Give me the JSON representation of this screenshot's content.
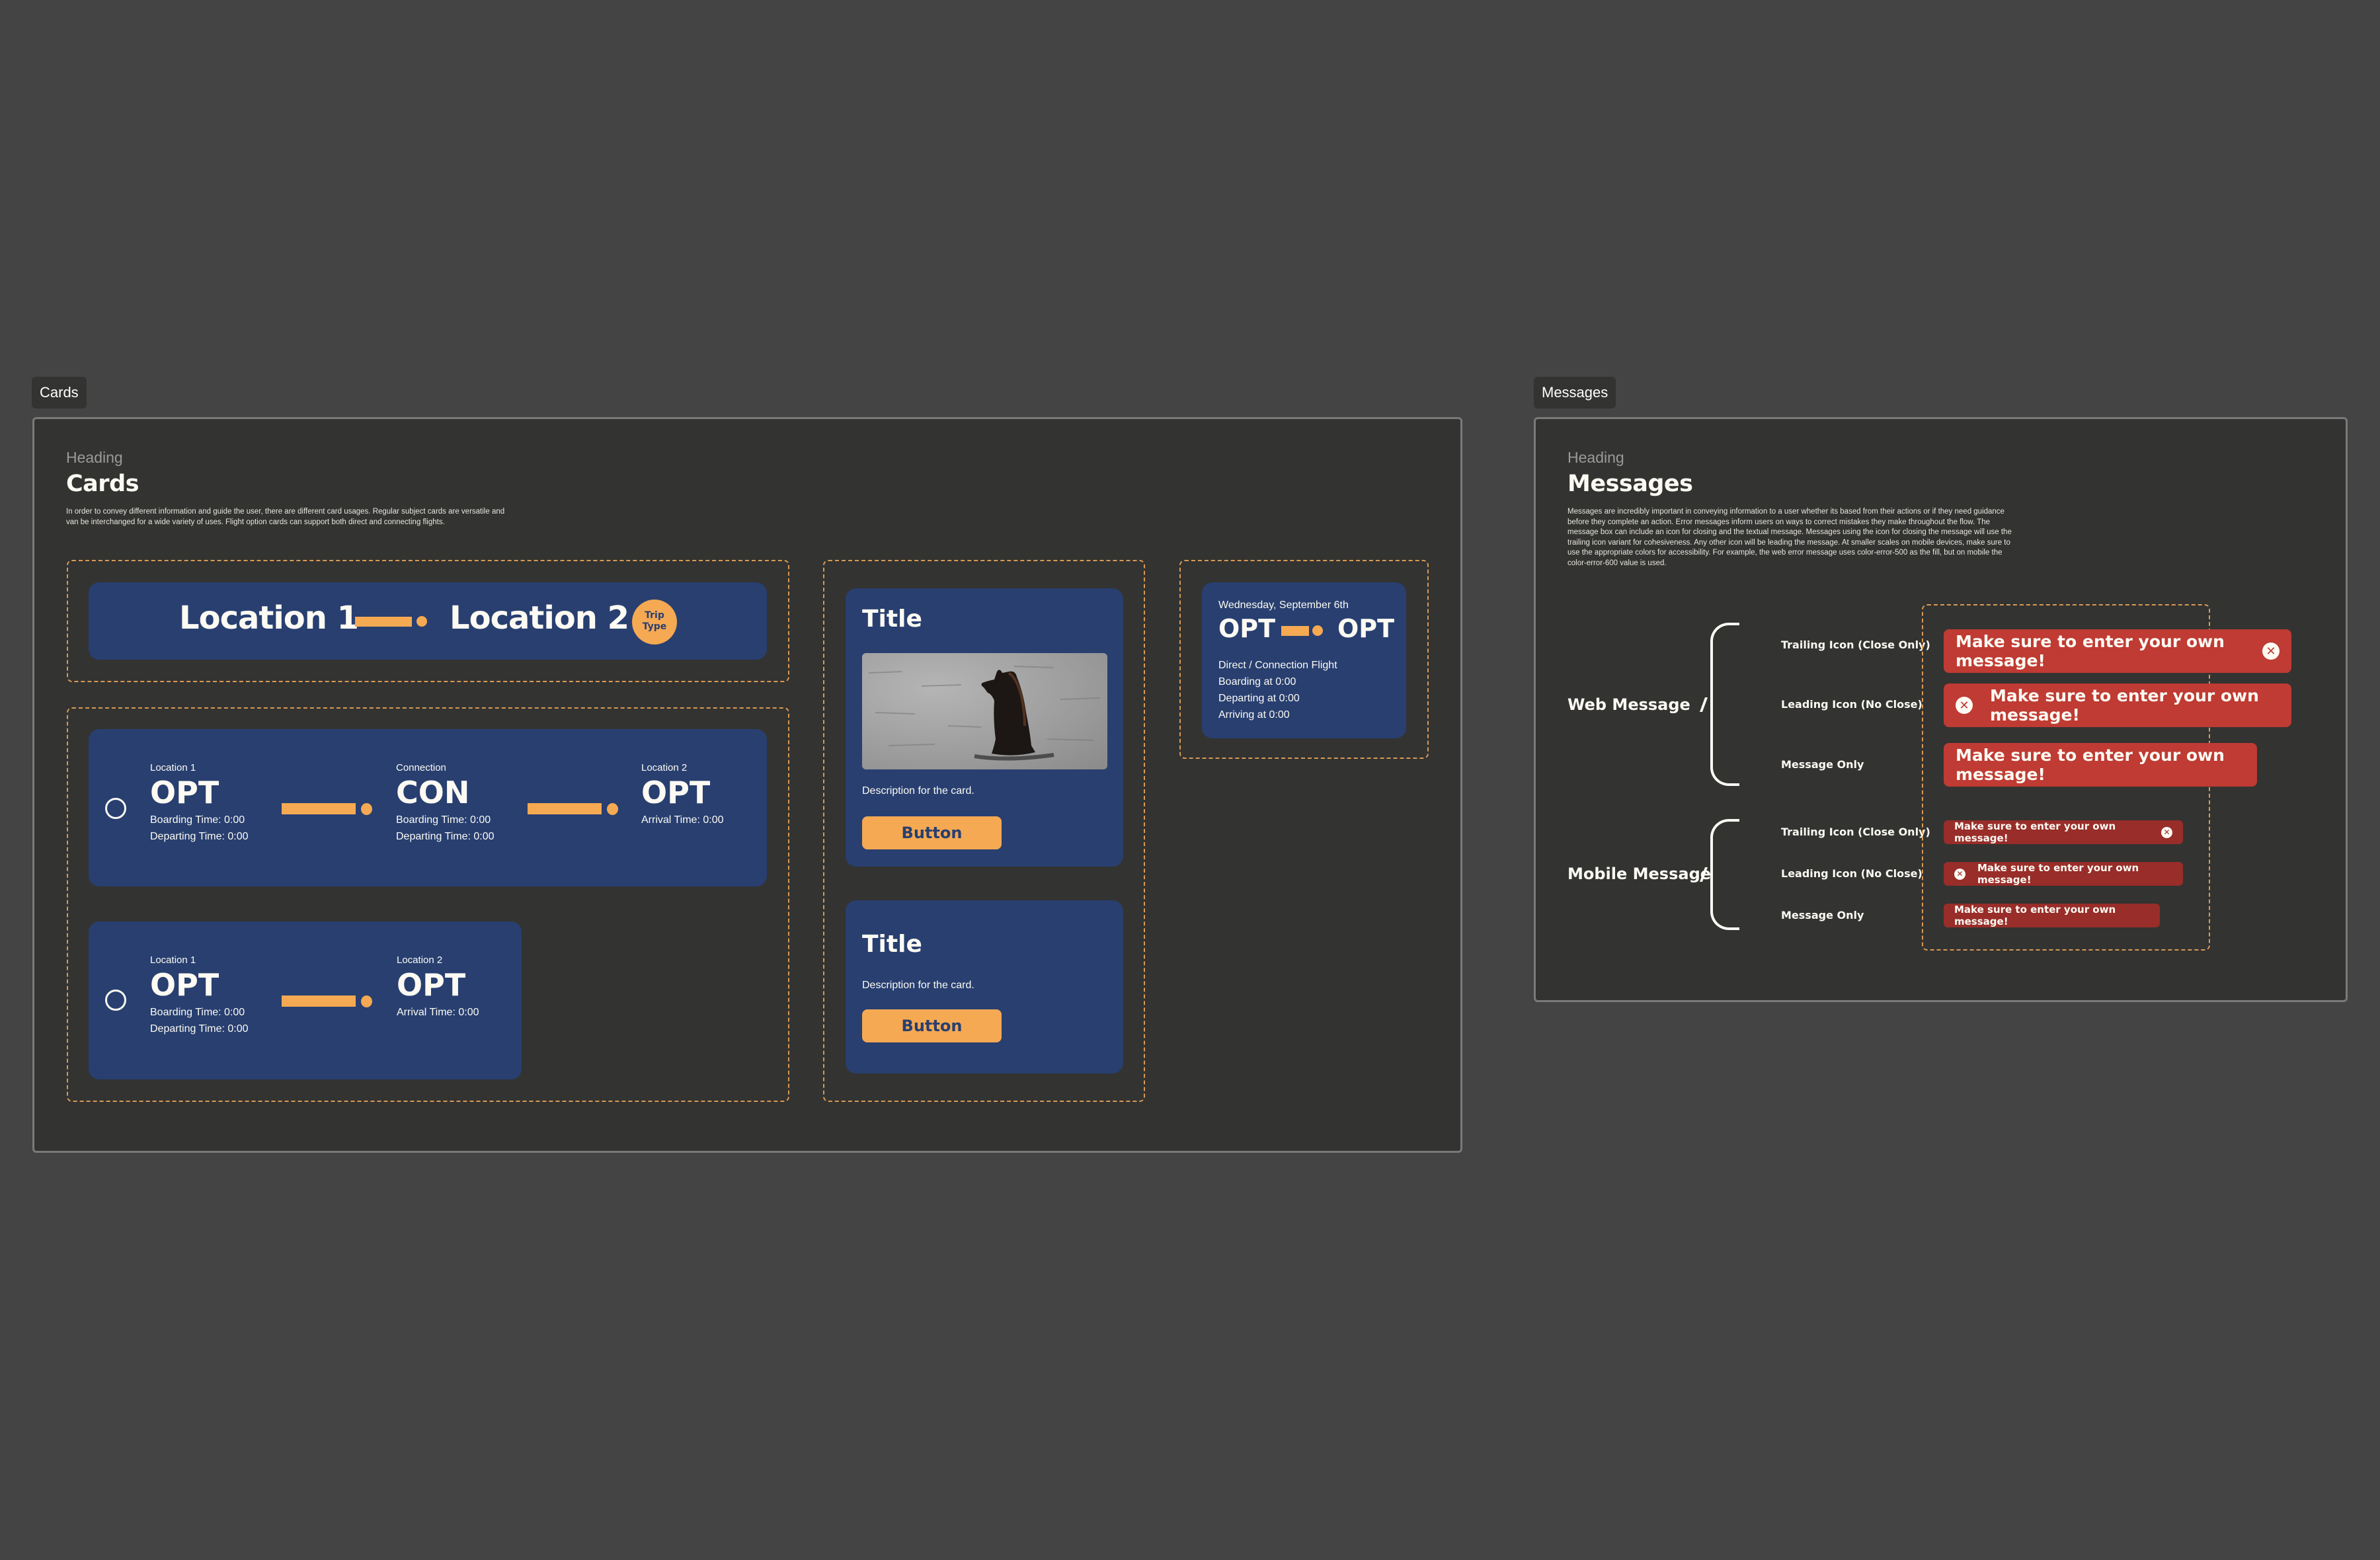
{
  "cards_section": {
    "tag_label": "Cards",
    "eyebrow": "Heading",
    "title": "Cards",
    "description_line1": "In order to convey different information and guide the user, there are different card usages. Regular subject cards are versatile and",
    "description_line2": "van be interchanged for a wide variety of uses.  Flight option cards can support both direct and connecting flights.",
    "route_card": {
      "origin": "Location 1",
      "destination": "Location 2",
      "badge_line1": "Trip",
      "badge_line2": "Type"
    },
    "connecting_card": {
      "stops": [
        {
          "label": "Location 1",
          "code": "OPT",
          "line1": "Boarding Time: 0:00",
          "line2": "Departing Time: 0:00"
        },
        {
          "label": "Connection",
          "code": "CON",
          "line1": "Boarding Time: 0:00",
          "line2": "Departing Time: 0:00"
        },
        {
          "label": "Location 2",
          "code": "OPT",
          "line1": "Arrival Time: 0:00"
        }
      ]
    },
    "direct_card": {
      "stops": [
        {
          "label": "Location 1",
          "code": "OPT",
          "line1": "Boarding Time: 0:00",
          "line2": "Departing Time: 0:00"
        },
        {
          "label": "Location 2",
          "code": "OPT",
          "line1": "Arrival Time: 0:00"
        }
      ]
    },
    "subject_cards": [
      {
        "title": "Title",
        "description": "Description for the card.",
        "button_label": "Button",
        "image_alt": "bear in water"
      },
      {
        "title": "Title",
        "description": "Description for the card.",
        "button_label": "Button"
      }
    ],
    "summary_card": {
      "date": "Wednesday, September 6th",
      "origin_code": "OPT",
      "destination_code": "OPT",
      "flight_type": "Direct / Connection Flight",
      "boarding": "Boarding at 0:00",
      "departing": "Departing at 0:00",
      "arriving": "Arriving at 0:00"
    }
  },
  "messages_section": {
    "tag_label": "Messages",
    "eyebrow": "Heading",
    "title": "Messages",
    "description_lines": [
      "Messages are incredibly important in conveying information to a user whether its based from their actions or if they need guidance",
      "before they complete an action. Error messages inform users on ways to correct mistakes they make throughout the flow. The",
      "message box can include an icon for closing and the textual message. Messages using the icon for closing the message will use the",
      "trailing icon variant for cohesiveness. Any other icon will be leading the message. At smaller scales on mobile devices, make sure to",
      "use the appropriate colors for accessibility. For example, the web error message uses color-error-500 as the fill, but on mobile the",
      "color-error-600 value is used."
    ],
    "web": {
      "group_label": "Web Message",
      "variants": [
        {
          "label": "Trailing Icon (Close Only)",
          "text": "Make sure to enter your own message!",
          "icon": "close-circle-icon"
        },
        {
          "label": "Leading Icon (No Close)",
          "text": "Make sure to enter your own message!",
          "icon": "error-circle-icon"
        },
        {
          "label": "Message Only",
          "text": "Make sure to enter your own message!"
        }
      ]
    },
    "mobile": {
      "group_label": "Mobile Message",
      "variants": [
        {
          "label": "Trailing Icon (Close Only)",
          "text": "Make sure to enter your own message!",
          "icon": "close-circle-icon"
        },
        {
          "label": "Leading Icon (No Close)",
          "text": "Make sure to enter your own message!",
          "icon": "error-circle-icon"
        },
        {
          "label": "Message Only",
          "text": "Make sure to enter your own message!"
        }
      ]
    },
    "icon_glyph": "✕"
  },
  "colors": {
    "canvas": "#444444",
    "frame": "#333331",
    "card_navy": "#283f70",
    "accent_orange": "#f5a953",
    "error_500": "#bf3b33",
    "error_600": "#982d29"
  }
}
